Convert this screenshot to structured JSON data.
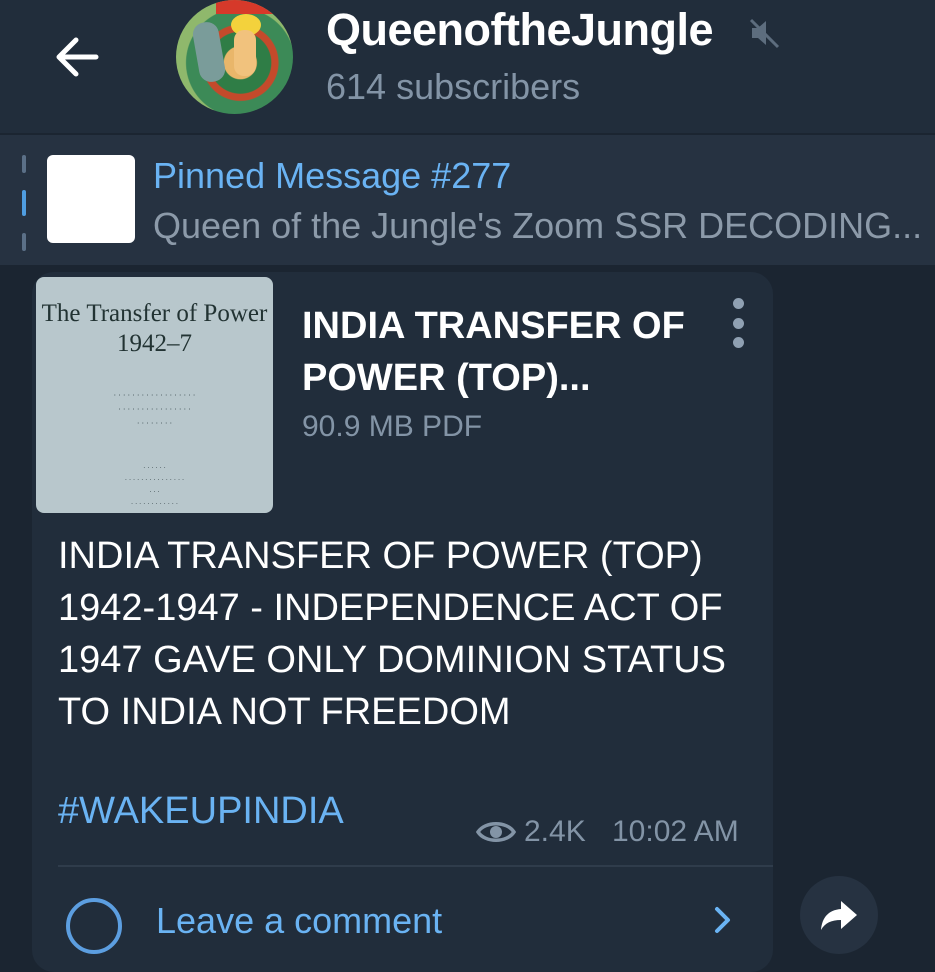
{
  "header": {
    "channel_name": "QueenoftheJungle",
    "subscribers": "614 subscribers",
    "back_icon": "arrow-left-icon",
    "mute_icon": "speaker-muted-icon"
  },
  "pinned": {
    "title": "Pinned Message #277",
    "preview": "Queen of the Jungle's Zoom SSR DECODING..."
  },
  "message": {
    "document": {
      "thumb_title": "The Transfer of Power 1942–7",
      "title": "INDIA TRANSFER OF POWER (TOP)...",
      "meta": "90.9 MB PDF"
    },
    "caption": "INDIA TRANSFER OF POWER (TOP) 1942-1947 - INDEPENDENCE ACT OF 1947 GAVE ONLY DOMINION STATUS TO INDIA NOT FREEDOM",
    "hashtag": "#WAKEUPINDIA",
    "views": "2.4K",
    "time": "10:02 AM",
    "comment_label": "Leave a comment"
  },
  "colors": {
    "background": "#1b2531",
    "bubble": "#212d3b",
    "accent": "#6ab3f3",
    "muted_text": "#8394a6"
  }
}
